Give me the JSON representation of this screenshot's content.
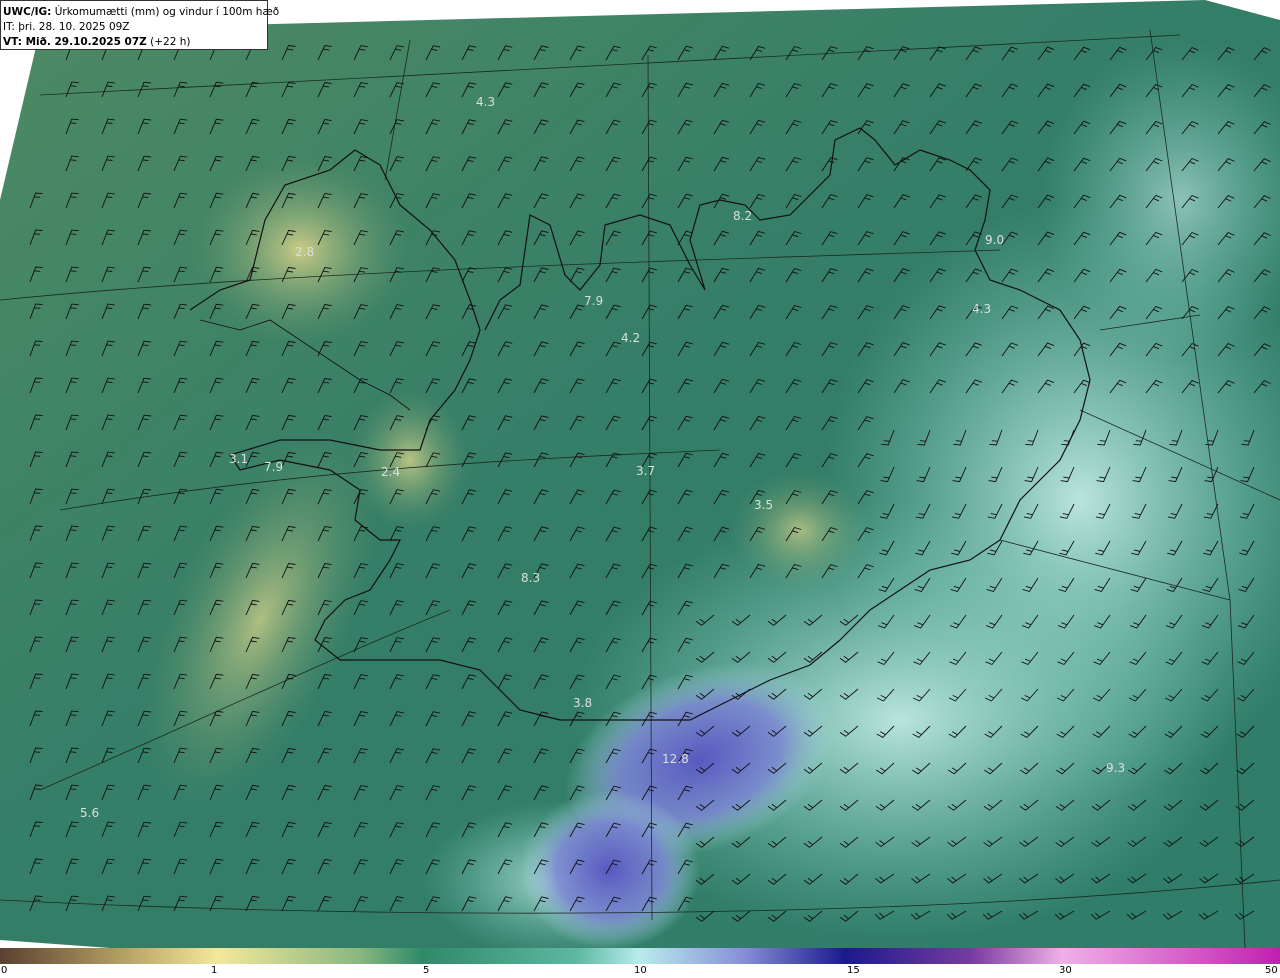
{
  "header": {
    "line1_prefix": "UWC/IG:",
    "line1_text": "Úrkomumætti (mm) og vindur í 100m hæð",
    "line2": "IT: þri. 28. 10. 2025 09Z",
    "line3_prefix": "VT: Mið. 29.10.2025 07Z",
    "line3_suffix": "(+22 h)"
  },
  "map_labels": [
    "4.3",
    "2.8",
    "7.9",
    "4.2",
    "8.2",
    "9.0",
    "4.3",
    "3.1",
    "7.9",
    "2.4",
    "3.7",
    "3.5",
    "8.3",
    "3.8",
    "12.8",
    "5.6",
    "9.3"
  ],
  "colorbar": {
    "ticks": [
      "0",
      "1",
      "5",
      "10",
      "15",
      "30",
      "50"
    ],
    "colors": [
      "#5a4030",
      "#c9b070",
      "#f4e89a",
      "#2f8a6a",
      "#3ea080",
      "#b8ecec",
      "#6f78d0",
      "#1a1a8c",
      "#b040a0",
      "#f0b0e8",
      "#c020b0"
    ]
  },
  "colors": {
    "land_green": "#3a8a6c",
    "sea_teal": "#2f7a64",
    "precip_blue": "#6d70cc",
    "coast": "#111111"
  }
}
